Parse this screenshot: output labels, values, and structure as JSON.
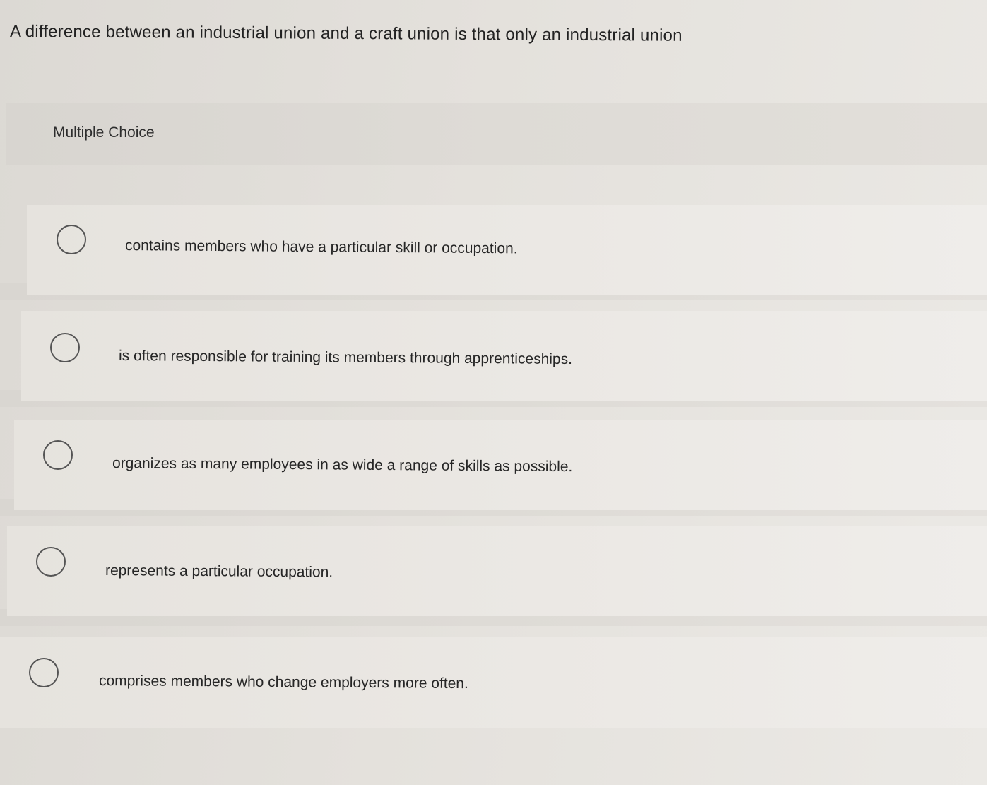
{
  "question": {
    "text": "A difference between an industrial union and a craft union is that only an industrial union"
  },
  "header": {
    "label": "Multiple Choice"
  },
  "options": [
    {
      "label": "contains members who have a particular skill or occupation.",
      "selected": false
    },
    {
      "label": "is often responsible for training its members through apprenticeships.",
      "selected": false
    },
    {
      "label": "organizes as many employees in as wide a range of skills as possible.",
      "selected": false
    },
    {
      "label": "represents a particular occupation.",
      "selected": false
    },
    {
      "label": "comprises members who change employers more often.",
      "selected": false
    }
  ],
  "colors": {
    "radio_border": "#555555",
    "text": "#262626"
  },
  "icons": {
    "radio": "radio-unselected-icon"
  }
}
